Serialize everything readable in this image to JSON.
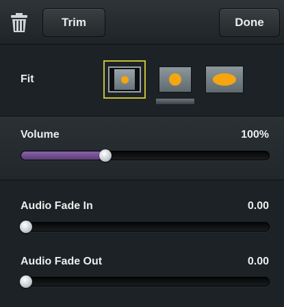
{
  "header": {
    "trash_icon": "trash-icon",
    "trim_label": "Trim",
    "done_label": "Done"
  },
  "fit": {
    "label": "Fit",
    "options": [
      "fit-letterbox",
      "fit-crop",
      "fit-stretch"
    ],
    "selected_index": 0
  },
  "volume": {
    "label": "Volume",
    "value_text": "100%",
    "slider_fraction": 0.34
  },
  "audio_fade_in": {
    "label": "Audio Fade In",
    "value_text": "0.00",
    "slider_fraction": 0.02
  },
  "audio_fade_out": {
    "label": "Audio Fade Out",
    "value_text": "0.00",
    "slider_fraction": 0.02
  },
  "colors": {
    "accent_orange": "#f4a50f",
    "selection_border": "#c8c13a",
    "volume_fill": "#7a5698"
  }
}
